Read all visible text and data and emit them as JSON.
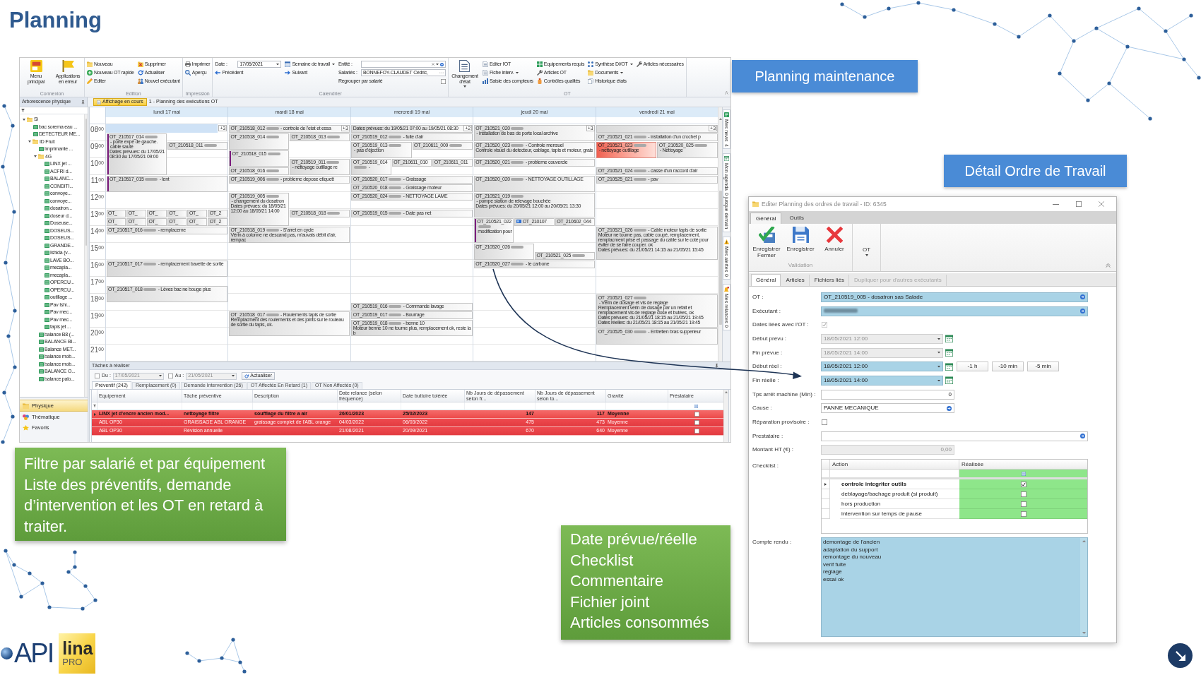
{
  "slide": {
    "title": "Planning"
  },
  "app": {
    "ribbon": {
      "groups": [
        {
          "label": "Connexion",
          "columns": [
            [
              {
                "kind": "large",
                "label": "Menu principal"
              }
            ],
            [
              {
                "kind": "large",
                "label": "Applications en erreur"
              }
            ]
          ]
        },
        {
          "label": "Edition",
          "columns": [
            [
              {
                "kind": "small",
                "label": "Nouveau"
              },
              {
                "kind": "small",
                "label": "Nouveau OT rapide"
              },
              {
                "kind": "small",
                "label": "Editer"
              }
            ],
            [
              {
                "kind": "small",
                "label": "Supprimer"
              },
              {
                "kind": "small",
                "label": "Actualiser"
              },
              {
                "kind": "small",
                "label": "Nouvel exécutant"
              }
            ]
          ]
        },
        {
          "label": "Impression",
          "columns": [
            [
              {
                "kind": "small",
                "label": "Imprimer"
              },
              {
                "kind": "small",
                "label": "Aperçu"
              }
            ]
          ]
        },
        {
          "label": "Calendrier",
          "columns": [
            [
              {
                "kind": "field",
                "label": "Date :",
                "value": "17/05/2021"
              },
              {
                "kind": "small",
                "label": "Précédent"
              }
            ],
            [
              {
                "kind": "menu",
                "label": "Semaine de travail"
              },
              {
                "kind": "small",
                "label": "Suivant"
              }
            ],
            [
              {
                "kind": "field",
                "label": "Entité :"
              },
              {
                "kind": "field",
                "label": "Salariés :",
                "value": "BONNEFOY-CLAUDET Cédric,"
              },
              {
                "kind": "checkbox",
                "label": "Regrouper par salarié",
                "checked": false
              }
            ]
          ]
        },
        {
          "label": "OT",
          "columns": [
            [
              {
                "kind": "largemenu",
                "label": "Changement d'état"
              }
            ],
            [
              {
                "kind": "small",
                "label": "Editer l'OT"
              },
              {
                "kind": "menu",
                "label": "Fiche interv."
              },
              {
                "kind": "small",
                "label": "Saisie des compteurs"
              }
            ],
            [
              {
                "kind": "small",
                "label": "Equipements requis"
              },
              {
                "kind": "small",
                "label": "Articles OT"
              },
              {
                "kind": "small",
                "label": "Contrôles qualités"
              }
            ],
            [
              {
                "kind": "menu",
                "label": "Synthèse DI/OT"
              },
              {
                "kind": "menu",
                "label": "Documents"
              },
              {
                "kind": "small",
                "label": "Historique états"
              }
            ],
            [
              {
                "kind": "small",
                "label": "Articles nécessaires"
              }
            ]
          ]
        }
      ]
    },
    "panes": {
      "tree_title": "Arborescence physique",
      "view_tab": "Affichage en cours",
      "view_title": "1 - Planning des exécutions OT"
    },
    "tree": [
      {
        "label": "Si",
        "kind": "folder",
        "expanded": true,
        "children": [
          {
            "label": "bac sorema eau ...",
            "kind": "equipment"
          },
          {
            "label": "DETECTEUR ME...",
            "kind": "equipment"
          },
          {
            "label": "ID Fruit",
            "kind": "folder",
            "expanded": true,
            "children": [
              {
                "label": "Imprimante ...",
                "kind": "equipment"
              },
              {
                "label": "4G",
                "kind": "folder",
                "expanded": true,
                "children": [
                  {
                    "label": "LINX jet ...",
                    "kind": "equipment"
                  },
                  {
                    "label": "ACFRI d...",
                    "kind": "equipment"
                  },
                  {
                    "label": "BALANC...",
                    "kind": "equipment"
                  },
                  {
                    "label": "CONDITI...",
                    "kind": "equipment"
                  },
                  {
                    "label": "convoye...",
                    "kind": "equipment"
                  },
                  {
                    "label": "convoye...",
                    "kind": "equipment"
                  },
                  {
                    "label": "dosatron...",
                    "kind": "equipment"
                  },
                  {
                    "label": "doseur d...",
                    "kind": "equipment"
                  },
                  {
                    "label": "Doseuse...",
                    "kind": "equipment"
                  },
                  {
                    "label": "DOSEUS...",
                    "kind": "equipment"
                  },
                  {
                    "label": "DOSEUS...",
                    "kind": "equipment"
                  },
                  {
                    "label": "GRANDE...",
                    "kind": "equipment"
                  },
                  {
                    "label": "Ishida (v...",
                    "kind": "equipment"
                  },
                  {
                    "label": "LAVE BO...",
                    "kind": "equipment"
                  },
                  {
                    "label": "mecapla...",
                    "kind": "equipment"
                  },
                  {
                    "label": "mecapla...",
                    "kind": "equipment"
                  },
                  {
                    "label": "OPERCU...",
                    "kind": "equipment"
                  },
                  {
                    "label": "OPERCU...",
                    "kind": "equipment"
                  },
                  {
                    "label": "outillage ...",
                    "kind": "equipment"
                  },
                  {
                    "label": "Pav Ishi...",
                    "kind": "equipment"
                  },
                  {
                    "label": "Pav mec...",
                    "kind": "equipment"
                  },
                  {
                    "label": "Pav mec...",
                    "kind": "equipment"
                  },
                  {
                    "label": "tapis jet ...",
                    "kind": "equipment"
                  }
                ]
              },
              {
                "label": "balance B8 (...",
                "kind": "equipment"
              },
              {
                "label": "BALANCE BI...",
                "kind": "equipment"
              },
              {
                "label": "Balance MET...",
                "kind": "equipment"
              },
              {
                "label": "balance mob...",
                "kind": "equipment"
              },
              {
                "label": "balance mob...",
                "kind": "equipment"
              },
              {
                "label": "BALANCE O...",
                "kind": "equipment"
              },
              {
                "label": "balance palo...",
                "kind": "equipment"
              }
            ]
          }
        ]
      }
    ],
    "nav": [
      {
        "label": "Physique",
        "selected": true
      },
      {
        "label": "Thématique",
        "selected": false
      },
      {
        "label": "Favoris",
        "selected": false
      }
    ],
    "calendar": {
      "days": [
        {
          "label": "lundi 17 mai",
          "more": "+3",
          "selected": true,
          "events": [
            {
              "kind": "standard",
              "code": "OT_210517_014",
              "redacted": true,
              "summary": "- porte expé de gauche. cable sauté",
              "notes": [
                "Dates prévues: du 17/05/21 08:30 au 17/05/21 09:00"
              ],
              "color": "#7b1c7e"
            },
            {
              "kind": "standard",
              "code": "OT_210518_011",
              "redacted": true
            },
            {
              "kind": "standard",
              "code": "OT_210517_015",
              "redacted": true,
              "summary": "- lent",
              "color": "#7b1c7e"
            },
            {
              "kind": "standard",
              "code": "OT_",
              "redacted": false
            },
            {
              "kind": "standard",
              "code": "OT_",
              "redacted": false
            },
            {
              "kind": "standard",
              "code": "OT_",
              "redacted": false
            },
            {
              "kind": "standard",
              "code": "OT_",
              "redacted": false
            },
            {
              "kind": "standard",
              "code": "OT_",
              "redacted": false
            },
            {
              "kind": "standard",
              "code": "OT_2",
              "redacted": false
            },
            {
              "kind": "standard",
              "code": "OT_",
              "redacted": false
            },
            {
              "kind": "standard",
              "code": "OT_",
              "redacted": false
            },
            {
              "kind": "standard",
              "code": "OT_",
              "redacted": false
            },
            {
              "kind": "standard",
              "code": "OT_",
              "redacted": false
            },
            {
              "kind": "standard",
              "code": "OT_",
              "redacted": false
            },
            {
              "kind": "standard",
              "code": "OT_2",
              "redacted": false
            },
            {
              "kind": "standard",
              "code": "OT_210517_016",
              "redacted": true,
              "summary": "- remplaceme"
            },
            {
              "kind": "standard",
              "code": "OT_210517_017",
              "redacted": true,
              "summary": "- remplacement bavette de sortie"
            },
            {
              "kind": "standard",
              "code": "OT_210517_018",
              "redacted": true,
              "summary": "- Lèves bac ne bouge plus"
            }
          ]
        },
        {
          "label": "mardi 18 mai",
          "more": "+3",
          "selected": false,
          "events": [
            {
              "kind": "standard",
              "code": "OT_210518_012",
              "redacted": true,
              "summary": "- controle de l'etat et essa"
            },
            {
              "kind": "standard",
              "code": "OT_210518_014",
              "redacted": true
            },
            {
              "kind": "standard",
              "code": "OT_210518_013",
              "redacted": true
            },
            {
              "kind": "standard",
              "code": "OT_210518_015",
              "redacted": true,
              "color": "#7b1c7e"
            },
            {
              "kind": "standard",
              "code": "OT_210519_011",
              "redacted": true,
              "summary": "- nettoyage outillage re"
            },
            {
              "kind": "standard",
              "code": "OT_210518_016",
              "redacted": true
            },
            {
              "kind": "standard",
              "code": "OT_210519_006",
              "redacted": true,
              "summary": "- probleme depose etiquett"
            },
            {
              "kind": "standard",
              "code": "OT_210519_005",
              "redacted": true,
              "summary": "- changement du dosatron",
              "notes": [
                "Dates prévues: du 18/05/21 12:00 au 18/05/21 14:00"
              ]
            },
            {
              "kind": "standard",
              "code": "OT_210518_018",
              "redacted": true
            },
            {
              "kind": "standard",
              "code": "OT_210518_019",
              "redacted": true,
              "summary": "- S'arret en cycle",
              "notes": [
                "Vérin à colonne ne descand pas, m'auvais débit d'air, rempac"
              ]
            },
            {
              "kind": "standard",
              "code": "OT_210518_017",
              "redacted": true,
              "summary": "- Roulements tapis de sortie",
              "notes": [
                "Remplacment des roulements et des joints sur le rouleau de sortie du tapis, ok."
              ]
            }
          ]
        },
        {
          "label": "mercredi 19 mai",
          "more": "+2",
          "selected": false,
          "events": [
            {
              "kind": "standard",
              "redacted": false,
              "notes": [
                "Dates prévues: du 19/05/21 07:00 au 19/05/21 08:30"
              ]
            },
            {
              "kind": "standard",
              "code": "OT_210519_012",
              "redacted": true,
              "summary": "- fuite d'air"
            },
            {
              "kind": "standard",
              "code": "OT_210519_013",
              "redacted": true,
              "summary": "- pas d'éjection"
            },
            {
              "kind": "standard",
              "code": "OT_210611_009",
              "redacted": true
            },
            {
              "kind": "standard",
              "code": "OT_210519_014",
              "redacted": true,
              "summary": "-"
            },
            {
              "kind": "standard",
              "code": "OT_210611_010",
              "redacted": false
            },
            {
              "kind": "standard",
              "code": "OT_210611_011",
              "redacted": false
            },
            {
              "kind": "standard",
              "code": "OT_210520_017",
              "redacted": true,
              "summary": "- Graissage"
            },
            {
              "kind": "standard",
              "code": "OT_210520_018",
              "redacted": true,
              "summary": "- Graissage moteur"
            },
            {
              "kind": "standard",
              "code": "OT_210520_024",
              "redacted": true,
              "summary": "- NETTOYAGE LAME"
            },
            {
              "kind": "standard",
              "code": "OT_210519_015",
              "redacted": true,
              "summary": "- Date pas net"
            },
            {
              "kind": "standard",
              "code": "OT_210519_016",
              "redacted": true,
              "summary": "- Commande lavage"
            },
            {
              "kind": "standard",
              "code": "OT_210519_017",
              "redacted": true,
              "summary": "- Bourrage"
            },
            {
              "kind": "standard",
              "code": "OT_210519_018",
              "redacted": true,
              "summary": "- benne 10",
              "notes": [
                "Moteur benne 10 ne tourne plus, remplacement ok, reste la b"
              ]
            }
          ]
        },
        {
          "label": "jeudi 20 mai",
          "more": "+3",
          "selected": false,
          "events": [
            {
              "kind": "standard",
              "code": "OT_210521_020",
              "redacted": true,
              "summary": "- installation de bas de porte local archive"
            },
            {
              "kind": "standard",
              "code": "OT_210520_023",
              "redacted": true,
              "summary": "- Controle mensuel",
              "notes": [
                "Controle visuel du detecteur, cablage, tapis et moteur, grais"
              ]
            },
            {
              "kind": "standard",
              "code": "OT_210520_021",
              "redacted": true,
              "summary": "- probleme couvercle"
            },
            {
              "kind": "standard",
              "code": "OT_210520_020",
              "redacted": true,
              "summary": "- NETTOYAGE OUTILLAGE"
            },
            {
              "kind": "standard",
              "code": "OT_210521_019",
              "redacted": true,
              "summary": "- pompe station de relevage bouchée",
              "notes": [
                "Dates prévues: du 20/05/21 12:00 au 20/05/21 13:30"
              ]
            },
            {
              "kind": "standard",
              "code": "OT_210521_022",
              "redacted": true,
              "summary": "modification pour",
              "color": "#7b1c7e"
            },
            {
              "kind": "linked",
              "code": "OT_210107",
              "redacted": false
            },
            {
              "kind": "standard",
              "code": "OT_210602_044",
              "redacted": false
            },
            {
              "kind": "standard",
              "code": "OT_210520_026",
              "redacted": true
            },
            {
              "kind": "standard",
              "code": "OT_210521_025",
              "redacted": true
            },
            {
              "kind": "standard",
              "code": "OT_210520_027",
              "redacted": true,
              "summary": "- le carbone"
            }
          ]
        },
        {
          "label": "vendredi 21 mai",
          "more": "+3",
          "selected": false,
          "events": [
            {
              "kind": "standard",
              "redacted": false
            },
            {
              "kind": "standard",
              "code": "OT_210521_021",
              "redacted": true,
              "summary": "- installation d'un crochet p"
            },
            {
              "kind": "alert",
              "code": "OT_210521_023",
              "redacted": true,
              "summary": "- nettoyage outillage"
            },
            {
              "kind": "standard",
              "code": "OT_210520_025",
              "redacted": true,
              "summary": "- Nettoyage"
            },
            {
              "kind": "standard",
              "code": "OT_210521_024",
              "redacted": true,
              "summary": "- casse d'un raccord d'air"
            },
            {
              "kind": "standard",
              "code": "OT_210525_021",
              "redacted": true,
              "summary": "- pav"
            },
            {
              "kind": "standard",
              "code": "OT_210521_026",
              "redacted": true,
              "summary": "- Cable moteur tapis de sortie",
              "notes": [
                "Moteur ne tourne pas, cable coupé, remplacement, remplacment prise et passage du cable sur le coté pour éviter de se faire couper. ok",
                "Dates prévues: du 21/05/21 14:15 au 21/05/21 15:45"
              ]
            },
            {
              "kind": "standard",
              "code": "OT_210521_027",
              "redacted": true,
              "summary": "- Vérin de dosage et vis de réglage",
              "notes": [
                "Remplacement vérin de dosage par un refait et remplacement vis de réglage dose et butées, ok",
                "Dates prévues: du 21/05/21 18:15 au 21/05/21 19:45",
                "Dates réelles: du 21/05/21 18:15 au 21/05/21 19:45"
              ]
            },
            {
              "kind": "standard",
              "code": "OT_210525_030",
              "redacted": true,
              "summary": "- Entretien bras supperieur"
            }
          ]
        }
      ],
      "hours": [
        {
          "hour": "08",
          "minutes": "00"
        },
        {
          "hour": "09",
          "minutes": "00"
        },
        {
          "hour": "10",
          "minutes": "00"
        },
        {
          "hour": "11",
          "minutes": "00"
        },
        {
          "hour": "12",
          "minutes": "00"
        },
        {
          "hour": "13",
          "minutes": "00"
        },
        {
          "hour": "14",
          "minutes": "00"
        },
        {
          "hour": "15",
          "minutes": "00"
        },
        {
          "hour": "16",
          "minutes": "00"
        },
        {
          "hour": "17",
          "minutes": "00"
        },
        {
          "hour": "18",
          "minutes": "00"
        },
        {
          "hour": "19",
          "minutes": "00"
        },
        {
          "hour": "20",
          "minutes": "00"
        },
        {
          "hour": "21",
          "minutes": "00"
        }
      ]
    },
    "side_tabs": [
      {
        "label": "Mes news",
        "count": "4"
      },
      {
        "label": "Mon agenda",
        "count": "0 jusque demain"
      },
      {
        "label": "Mes alertes",
        "count": "0"
      },
      {
        "label": "Mes relances",
        "count": "0"
      }
    ],
    "tasks": {
      "title": "Tâches à réaliser",
      "filters": [
        {
          "label": "Du :",
          "value": "17/05/2021",
          "checked": false
        },
        {
          "label": "Au :",
          "value": "21/05/2021",
          "checked": false
        }
      ],
      "refresh": "Actualiser",
      "tabs": [
        {
          "label": "Préventif (242)",
          "selected": true
        },
        {
          "label": "Remplacement (0)",
          "selected": false
        },
        {
          "label": "Demande Intervention (26)",
          "selected": false
        },
        {
          "label": "OT Affectés En Retard (1)",
          "selected": false
        },
        {
          "label": "OT Non Affectés (0)",
          "selected": false
        }
      ],
      "columns": [
        "Equipement",
        "Tâche préventive",
        "Description",
        "Date relance (selon fréquence)",
        "Date buttoire tolérée",
        "Nb Jours de dépassement selon fr...",
        "Nb Jours de dépassement selon to...",
        "Gravité",
        "Préstataire"
      ],
      "rows": [
        {
          "selected": true,
          "late": true,
          "equipement": "LINX jet d'encre ancien mod...",
          "tache": "nettoyage filtre",
          "description": "soufflage du filtre a air",
          "date_relance": "26/01/2023",
          "date_buttoire": "25/02/2023",
          "depassement_frequence": "147",
          "depassement_tolerance": "117",
          "gravite": "Moyenne",
          "checked": false
        },
        {
          "selected": false,
          "late": true,
          "equipement": "ABL OP30",
          "tache": "GRAISSAGE ABL ORANGE",
          "description": "graissage complet de l'ABL orange",
          "date_relance": "04/03/2022",
          "date_buttoire": "06/03/2022",
          "depassement_frequence": "475",
          "depassement_tolerance": "473",
          "gravite": "Moyenne",
          "checked": false
        },
        {
          "selected": false,
          "late": true,
          "equipement": "ABL OP30",
          "tache": "Révision annuelle",
          "date_relance": "21/08/2021",
          "date_buttoire": "20/09/2021",
          "depassement_frequence": "670",
          "depassement_tolerance": "640",
          "gravite": "Moyenne",
          "checked": false
        }
      ]
    }
  },
  "callouts": [
    {
      "text": "Planning maintenance"
    },
    {
      "text": "Détail Ordre de Travail"
    }
  ],
  "dialog": {
    "title": "Editer Planning des ordres de travail - ID: 6345",
    "ribbon_tabs": [
      {
        "label": "Général",
        "selected": true
      },
      {
        "label": "Outils",
        "selected": false
      }
    ],
    "actions": [
      {
        "label": "Enregistrer Fermer"
      },
      {
        "label": "Enregistrer"
      },
      {
        "label": "Annuler"
      }
    ],
    "group_label": "Validation",
    "menu": {
      "label": "OT"
    },
    "tabs": [
      {
        "label": "Général",
        "selected": true,
        "disabled": false
      },
      {
        "label": "Articles",
        "selected": false,
        "disabled": false
      },
      {
        "label": "Fichiers liés",
        "selected": false,
        "disabled": false
      },
      {
        "label": "Dupliquer pour d'autres exécutants",
        "selected": false,
        "disabled": true
      }
    ],
    "fields": [
      {
        "kind": "lookup",
        "label": "OT :",
        "value": "OT_210519_005 - dosatron sas Salade",
        "required": true,
        "redacted": false
      },
      {
        "kind": "lookup",
        "label": "Exécutant :",
        "required": true,
        "redacted": true
      },
      {
        "kind": "checkbox",
        "label": "Dates liées avec l'OT :",
        "checked": true,
        "disabled": true
      },
      {
        "kind": "datetime",
        "label": "Début prévu :",
        "value": "18/05/2021 12:00",
        "disabled": true,
        "required": false
      },
      {
        "kind": "datetime",
        "label": "Fin prévue :",
        "value": "18/05/2021 14:00",
        "disabled": true,
        "required": false
      },
      {
        "kind": "datetime",
        "label": "Début réel :",
        "value": "18/05/2021 12:00",
        "disabled": false,
        "required": true,
        "buttons": [
          "-1 h",
          "-10 min",
          "-5 min"
        ]
      },
      {
        "kind": "datetime",
        "label": "Fin réelle :",
        "value": "18/05/2021 14:00",
        "disabled": false,
        "required": true
      },
      {
        "kind": "number",
        "label": "Tps arrêt machine (Min) :",
        "value": "0",
        "disabled": false
      },
      {
        "kind": "choice",
        "label": "Cause :",
        "value": "PANNE MECANIQUE",
        "required": false
      },
      {
        "kind": "checkbox",
        "label": "Réparation provisoire :",
        "checked": false,
        "disabled": false
      },
      {
        "kind": "lookup",
        "label": "Prestataire :",
        "required": false,
        "redacted": false
      },
      {
        "kind": "number",
        "label": "Montant HT (€) :",
        "value": "0,00",
        "disabled": true
      }
    ],
    "checklist": {
      "label": "Checklist :",
      "columns": [
        "Action",
        "Réalisée"
      ],
      "rows": [
        {
          "action": "controle integriter outils",
          "checked": true,
          "selected": true
        },
        {
          "action": "deblayage/bachage produit (si produit)",
          "checked": false,
          "selected": false
        },
        {
          "action": "hors production",
          "checked": false,
          "selected": false
        },
        {
          "action": "intervention sur temps de pause",
          "checked": false,
          "selected": false
        }
      ]
    },
    "report": {
      "label": "Compte rendu :",
      "required": true,
      "lines": [
        "demontage de l'ancien",
        "adaptation du support",
        "remontage du nouveau",
        "verif fuite",
        "reglage",
        "essai ok"
      ]
    }
  },
  "notes": [
    {
      "lines": [
        "Filtre par salarié et par équipement",
        "Liste des préventifs, demande d’intervention et les OT en retard à traiter."
      ]
    },
    {
      "lines": [
        "Date prévue/réelle",
        "Checklist",
        "Commentaire",
        "Fichier joint",
        "Articles consommés"
      ]
    }
  ],
  "logo": {
    "name": "API",
    "product": "lina",
    "edition": "PRO"
  }
}
